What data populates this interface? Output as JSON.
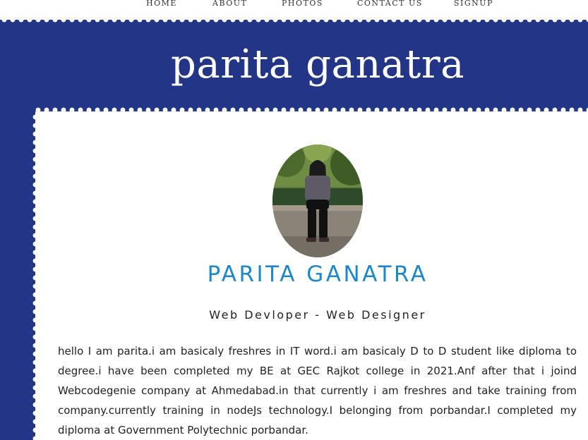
{
  "nav": {
    "items": [
      "HOME",
      "ABOUT",
      "PHOTOS",
      "CONTACT US",
      "SIGNUP"
    ]
  },
  "header": {
    "title": "parita ganatra"
  },
  "profile": {
    "name": "PARITA GANATRA",
    "role": "Web Devloper - Web Designer",
    "bio": "hello I am parita.i am basicaly freshres in IT word.i am basicaly D to D student like diploma to degree.i have been completed my BE at GEC Rajkot college in 2021.Anf after that i joind Webcodegenie company at Ahmedabad.in that currently i am freshres and take training from company.currently training in nodeJs technology.I belonging from porbandar.I completed my diploma at Government Polytechnic porbandar."
  },
  "colors": {
    "band": "#233587",
    "accent": "#1c87c9",
    "text": "#222222",
    "background": "#ffffff"
  }
}
